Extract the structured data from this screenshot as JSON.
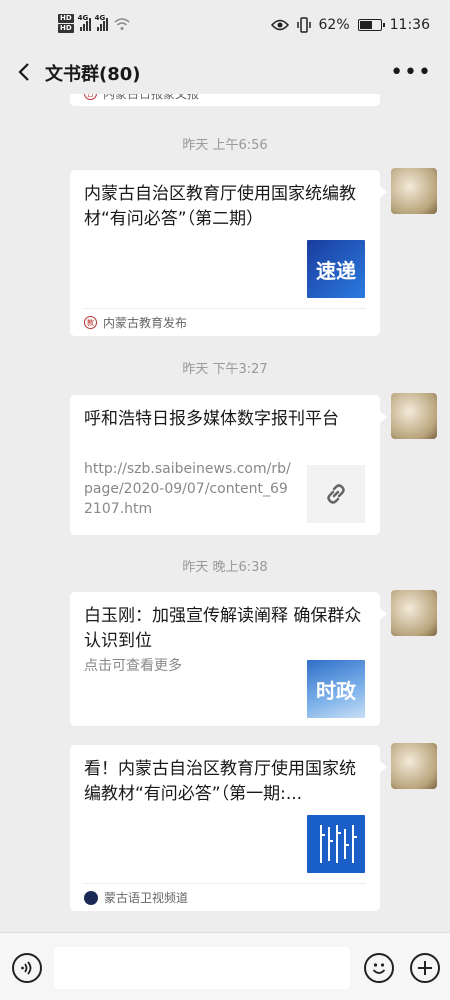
{
  "status": {
    "hd1": "HD",
    "hd2": "HD",
    "net1": "4G",
    "net2": "4G",
    "battery_pct": "62%",
    "battery_level": 0.62,
    "time": "11:36"
  },
  "header": {
    "title": "文书群(80)",
    "back_icon": "chevron-left-icon",
    "more_label": "•••"
  },
  "chat": {
    "partial_source": "内蒙古日报蒙文报",
    "t1": "昨天 上午6:56",
    "card1": {
      "title": "内蒙古自治区教育厅使用国家统编教材“有问必答”（第二期）",
      "thumb_text": "速递",
      "source": "内蒙古教育发布"
    },
    "t2": "昨天 下午3:27",
    "card2": {
      "title": "呼和浩特日报多媒体数字报刊平台",
      "url": "http://szb.saibeinews.com/rb/page/2020-09/07/content_692107.htm",
      "link_icon": "link-icon"
    },
    "t3": "昨天 晚上6:38",
    "card3": {
      "title": "白玉刚：加强宣传解读阐释 确保群众认识到位",
      "desc": "点击可查看更多",
      "thumb_text": "时政"
    },
    "card4": {
      "title": "看！内蒙古自治区教育厅使用国家统编教材“有问必答”（第一期:...",
      "source": "蒙古语卫视频道"
    }
  },
  "colors": {
    "bg": "#ededed",
    "card": "#ffffff",
    "thumb_blue": "#1c4fb8",
    "accent_time": "#999999"
  }
}
